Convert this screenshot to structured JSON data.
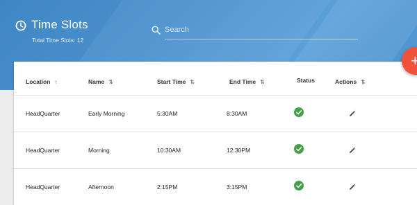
{
  "header": {
    "title": "Time Slots",
    "subtitle": "Total Time Slots: 12",
    "search_placeholder": "Search",
    "clock_icon": "clock-icon",
    "search_icon": "search-icon"
  },
  "fab": {
    "label": "+",
    "color": "#f0513a"
  },
  "table": {
    "columns": [
      {
        "label": "Location",
        "sort": "⌃"
      },
      {
        "label": "Name",
        "sort": "⬍"
      },
      {
        "label": "Start Time",
        "sort": "⬍"
      },
      {
        "label": "End Time",
        "sort": "⬍"
      },
      {
        "label": "Status",
        "sort": ""
      },
      {
        "label": "Actions",
        "sort": "⬍"
      }
    ],
    "rows": [
      {
        "location": "HeadQuarter",
        "name": "Early Morning",
        "start": "5:30AM",
        "end": "8:30AM",
        "status": "active"
      },
      {
        "location": "HeadQuarter",
        "name": "Morning",
        "start": "10:30AM",
        "end": "12:30PM",
        "status": "active"
      },
      {
        "location": "HeadQuarter",
        "name": "Afternoon",
        "start": "2:15PM",
        "end": "3:15PM",
        "status": "active"
      }
    ]
  },
  "colors": {
    "header": "#4a90cc",
    "status_ok": "#43a047",
    "accent": "#f0513a"
  }
}
